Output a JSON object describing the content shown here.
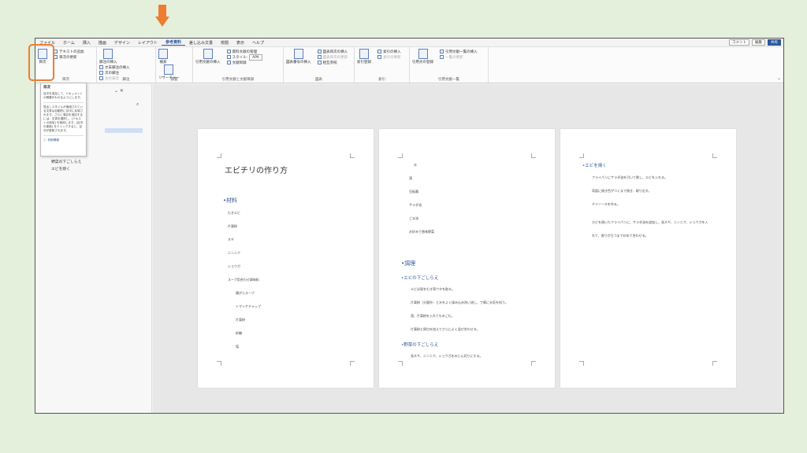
{
  "menu": {
    "tabs": [
      "ファイル",
      "ホーム",
      "挿入",
      "描画",
      "デザイン",
      "レイアウト",
      "参考資料",
      "差し込み文書",
      "校閲",
      "表示",
      "ヘルプ"
    ],
    "active_index": 6,
    "comment_btn": "コメント",
    "edit_btn": "編集",
    "share_btn": "共有"
  },
  "ribbon": {
    "toc": {
      "big": "目次",
      "update_text": "テキストの追加",
      "update_toc": "目次の更新",
      "label": "目次"
    },
    "footnote": {
      "big": "脚注の挿入",
      "endnote": "文末脚注の挿入",
      "next": "次の脚注",
      "show": "注の表示",
      "label": "脚注"
    },
    "research": {
      "search": "検索",
      "researcher": "リサーチャー",
      "label": "調査"
    },
    "citation": {
      "insert": "引用文献の挿入",
      "manage": "資料文献の管理",
      "style_label": "スタイル:",
      "style_value": "APA",
      "bib": "文献目録",
      "label": "引用文献と文献目録"
    },
    "caption": {
      "insert": "図表番号の挿入",
      "table_of_figures": "図表目次の挿入",
      "update": "図表目次の更新",
      "cross_ref": "相互参照",
      "label": "図表"
    },
    "index": {
      "mark": "索引登録",
      "insert": "索引の挿入",
      "update": "索引の更新",
      "label": "索引"
    },
    "authorities": {
      "mark": "引用文の登録",
      "insert": "引用文献一覧の挿入",
      "update": "一覧の更新",
      "label": "引用文献一覧"
    }
  },
  "tooltip": {
    "title": "目次",
    "p1": "目次を追加して、ドキュメントの概要がわかるようにします。",
    "p2": "見出しスタイルが適用されている文書は自動的に目次に反映されます。さらに項目を追加するには、文書を選択し、[テキストの追加] を使用します。[目次の更新] をクリックすると、目次が更新されます。",
    "link": "詳細情報"
  },
  "navpane": {
    "items": [
      "野菜の下ごしらえ",
      "エビを焼く"
    ]
  },
  "page1": {
    "title": "エビチリの作り方",
    "materials_heading": "材料",
    "items": [
      "むきエビ",
      "片栗粉",
      "ネギ",
      "ニンニク",
      "ショウガ",
      "スープ用合わせ調味料"
    ],
    "sub_items": [
      "鶏がらスープ",
      "トマトケチャップ",
      "片栗粉",
      "砂糖",
      "塩"
    ]
  },
  "page2": {
    "top_items": [
      "水",
      "酒",
      "豆板醤",
      "サラダ油",
      "ごま油",
      "お好みで香味野菜"
    ],
    "heading": "調理",
    "sub1": "エビの下ごしらえ",
    "sub1_lines": [
      "エビは殻をむき背ワタを取る。",
      "片栗粉（分量外）と水をよく揉み込み洗い流し、丁寧に水気を拭う。",
      "酒、片栗粉を入れてもみこむ。",
      "片栗粉と卵白を加えてさらによく混ぜ合わせる。"
    ],
    "sub2": "野菜の下ごしらえ",
    "sub2_lines": [
      "長ネギ、ニンニク、ショウガをみじん切りにする。"
    ]
  },
  "page3": {
    "sub": "エビを焼く",
    "lines": [
      "フライパンにサラダ油を引いて熱し、エビを入れる。",
      "両面に焼き色がつくまで焼き、取り出す。",
      "チリソースを作る。",
      "エビを焼いたフライパンに、サラダ油を追加し、長ネギ、ニンニク、ショウガを入れて、香りが立つまで炒めて合わせる。"
    ]
  },
  "colors": {
    "accent": "#ee7d31",
    "word_blue": "#2b579a",
    "heading_blue": "#2f5597"
  }
}
